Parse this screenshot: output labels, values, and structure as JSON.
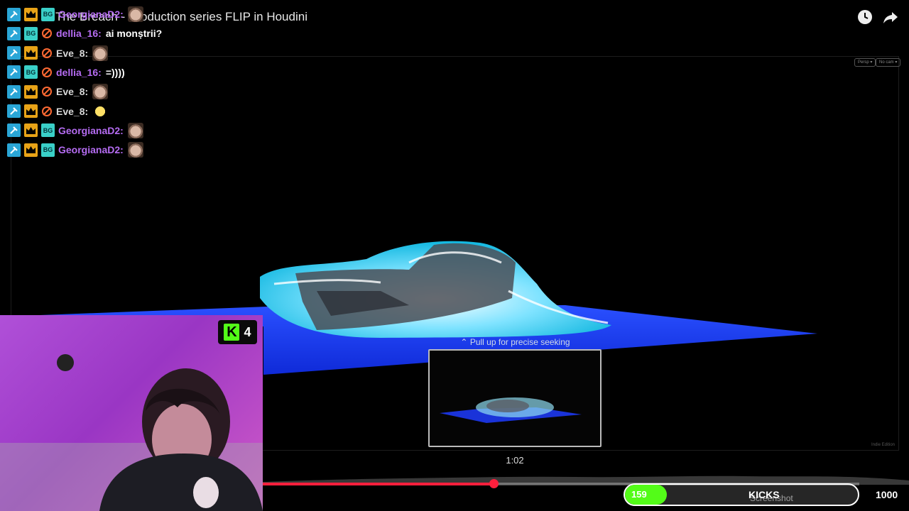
{
  "video": {
    "title": "The Breach - Production series FLIP in Houdini",
    "preview_time": "1:02",
    "pull_up_hint": "Pull up for precise seeking",
    "progress": 0.387,
    "screenshot_label": "Screenshot"
  },
  "viewport": {
    "persp_label": "Persp ▾",
    "cam_label": "No cam ▾",
    "edition_label": "Indie Edition"
  },
  "chat": {
    "messages": [
      {
        "user": "GeorgianaD2:",
        "text": "",
        "color": "#b56cf2",
        "emote": "cat"
      },
      {
        "user": "dellia_16:",
        "text": "ai monștrii?",
        "color": "#b56cf2",
        "emote": ""
      },
      {
        "user": "Eve_8:",
        "text": "",
        "color": "#d9d9d9",
        "emote": "cat"
      },
      {
        "user": "dellia_16:",
        "text": "=))))",
        "color": "#b56cf2",
        "emote": ""
      },
      {
        "user": "Eve_8:",
        "text": "",
        "color": "#d9d9d9",
        "emote": "cat"
      },
      {
        "user": "Eve_8:",
        "text": "",
        "color": "#d9d9d9",
        "emote": "chick"
      },
      {
        "user": "GeorgianaD2:",
        "text": "",
        "color": "#b56cf2",
        "emote": "cat"
      },
      {
        "user": "GeorgianaD2:",
        "text": "",
        "color": "#b56cf2",
        "emote": "cat"
      }
    ]
  },
  "kicks_badge": {
    "count": "4"
  },
  "goal": {
    "current": "159",
    "label": "KICKS",
    "target": "1000",
    "fraction": 0.159
  },
  "colors": {
    "accent_red": "#ff1f3d",
    "kick_green": "#53fc18",
    "water_blue": "#1a3cff"
  }
}
